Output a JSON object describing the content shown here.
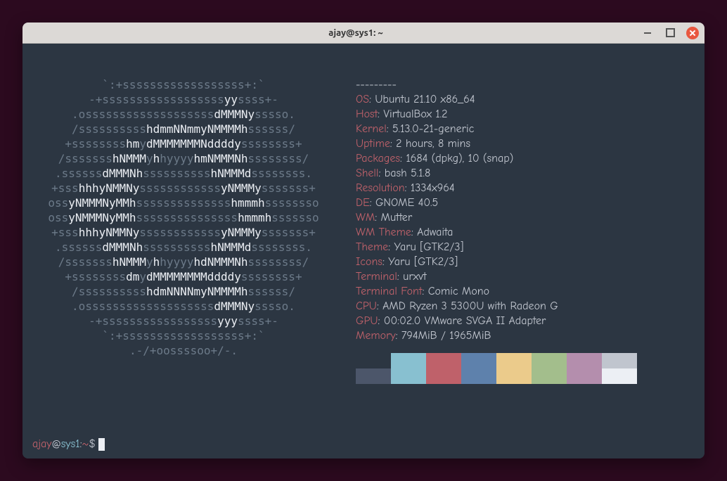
{
  "window": {
    "title": "ajay@sys1: ~"
  },
  "logo_lines": [
    [
      [
        "dim",
        "`:+"
      ],
      [
        "dim",
        "ssssssssssssssssss"
      ],
      [
        "dim",
        "+:`"
      ]
    ],
    [
      [
        "dim",
        "-+"
      ],
      [
        "dim",
        "ssssssssssssssssss"
      ],
      [
        "white",
        "yy"
      ],
      [
        "dim",
        "ssss"
      ],
      [
        "dim",
        "+-"
      ]
    ],
    [
      [
        "dim",
        ".o"
      ],
      [
        "dim",
        "sssssssssssssssssss"
      ],
      [
        "white",
        "dMMMNy"
      ],
      [
        "dim",
        "sssso."
      ]
    ],
    [
      [
        "dim",
        "/"
      ],
      [
        "dim",
        "ssssssssss"
      ],
      [
        "white",
        "hdmmNNmmyNMMMMh"
      ],
      [
        "dim",
        "ssssss/"
      ]
    ],
    [
      [
        "dim",
        "+"
      ],
      [
        "dim",
        "ssssssss"
      ],
      [
        "white",
        "hm"
      ],
      [
        "dim",
        "y"
      ],
      [
        "white",
        "dMMMMMMMNddddy"
      ],
      [
        "dim",
        "ssssssss+"
      ]
    ],
    [
      [
        "dim",
        "/"
      ],
      [
        "dim",
        "sssssss"
      ],
      [
        "white",
        "hNMMM"
      ],
      [
        "dim",
        "y"
      ],
      [
        "white",
        "h"
      ],
      [
        "dim",
        "hyyyy"
      ],
      [
        "white",
        "hmNMMMNh"
      ],
      [
        "dim",
        "ssssssss/"
      ]
    ],
    [
      [
        "dim",
        ".ssssss"
      ],
      [
        "white",
        "dMMMNh"
      ],
      [
        "dim",
        "ssssssssss"
      ],
      [
        "white",
        "hNMMMd"
      ],
      [
        "dim",
        "ssssssss."
      ]
    ],
    [
      [
        "dim",
        "+sss"
      ],
      [
        "white",
        "hhhyNMMNy"
      ],
      [
        "dim",
        "ssssssssssss"
      ],
      [
        "white",
        "yNMMMy"
      ],
      [
        "dim",
        "sssssss+"
      ]
    ],
    [
      [
        "dim",
        "oss"
      ],
      [
        "white",
        "yNMMMNyMMh"
      ],
      [
        "dim",
        "ssssssssssssss"
      ],
      [
        "white",
        "hmmmh"
      ],
      [
        "dim",
        "ssssssso"
      ]
    ],
    [
      [
        "dim",
        "oss"
      ],
      [
        "white",
        "yNMMMNyMMh"
      ],
      [
        "dim",
        "sssssssssssssss"
      ],
      [
        "white",
        "hmmmh"
      ],
      [
        "dim",
        "sssssso"
      ]
    ],
    [
      [
        "dim",
        "+sss"
      ],
      [
        "white",
        "hhhyNMMNy"
      ],
      [
        "dim",
        "ssssssssssss"
      ],
      [
        "white",
        "yNMMMy"
      ],
      [
        "dim",
        "sssssss+"
      ]
    ],
    [
      [
        "dim",
        ".ssssss"
      ],
      [
        "white",
        "dMMMNh"
      ],
      [
        "dim",
        "ssssssssss"
      ],
      [
        "white",
        "hNMMMd"
      ],
      [
        "dim",
        "ssssssss."
      ]
    ],
    [
      [
        "dim",
        "/"
      ],
      [
        "dim",
        "sssssss"
      ],
      [
        "white",
        "hNMMM"
      ],
      [
        "dim",
        "y"
      ],
      [
        "white",
        "h"
      ],
      [
        "dim",
        "hyyyy"
      ],
      [
        "white",
        "hdNMMMNh"
      ],
      [
        "dim",
        "ssssssss/"
      ]
    ],
    [
      [
        "dim",
        "+"
      ],
      [
        "dim",
        "ssssssss"
      ],
      [
        "white",
        "dm"
      ],
      [
        "dim",
        "y"
      ],
      [
        "white",
        "dMMMMMMMMddddy"
      ],
      [
        "dim",
        "ssssssss+"
      ]
    ],
    [
      [
        "dim",
        "/"
      ],
      [
        "dim",
        "ssssssssss"
      ],
      [
        "white",
        "hdmNNNNmyNMMMMh"
      ],
      [
        "dim",
        "ssssss/"
      ]
    ],
    [
      [
        "dim",
        ".o"
      ],
      [
        "dim",
        "sssssssssssssssssss"
      ],
      [
        "white",
        "dMMMNy"
      ],
      [
        "dim",
        "sssso."
      ]
    ],
    [
      [
        "dim",
        "-+"
      ],
      [
        "dim",
        "sssssssssssssssss"
      ],
      [
        "white",
        "yyy"
      ],
      [
        "dim",
        "ssss"
      ],
      [
        "dim",
        "+-"
      ]
    ],
    [
      [
        "dim",
        "`:+"
      ],
      [
        "dim",
        "ssssssssssssssssss"
      ],
      [
        "dim",
        "+:`"
      ]
    ],
    [
      [
        "dim",
        ".-/+oossssoo+/-."
      ]
    ]
  ],
  "header_rule": "---------",
  "info": [
    {
      "label": "OS",
      "value": "Ubuntu 21.10 x86_64"
    },
    {
      "label": "Host",
      "value": "VirtualBox 1.2"
    },
    {
      "label": "Kernel",
      "value": "5.13.0-21-generic"
    },
    {
      "label": "Uptime",
      "value": "2 hours, 8 mins"
    },
    {
      "label": "Packages",
      "value": "1684 (dpkg), 10 (snap)"
    },
    {
      "label": "Shell",
      "value": "bash 5.1.8"
    },
    {
      "label": "Resolution",
      "value": "1334x964"
    },
    {
      "label": "DE",
      "value": "GNOME 40.5"
    },
    {
      "label": "WM",
      "value": "Mutter"
    },
    {
      "label": "WM Theme",
      "value": "Adwaita"
    },
    {
      "label": "Theme",
      "value": "Yaru [GTK2/3]"
    },
    {
      "label": "Icons",
      "value": "Yaru [GTK2/3]"
    },
    {
      "label": "Terminal",
      "value": "urxvt"
    },
    {
      "label": "Terminal Font",
      "value": "Comic Mono"
    },
    {
      "label": "CPU",
      "value": "AMD Ryzen 3 5300U with Radeon G"
    },
    {
      "label": "GPU",
      "value": "00:02.0 VMware SVGA II Adapter"
    },
    {
      "label": "Memory",
      "value": "794MiB / 1965MiB"
    }
  ],
  "palette": {
    "row1": [
      "#2c3642",
      "#88c0d0",
      "#bf616a",
      "#5e81ac",
      "#ebcb8b",
      "#a3be8c",
      "#b48ead",
      "#c0c5ce"
    ],
    "row2": [
      "#4c566a",
      "#88c0d0",
      "#bf616a",
      "#5e81ac",
      "#ebcb8b",
      "#a3be8c",
      "#b48ead",
      "#eceff4"
    ]
  },
  "prompt": {
    "user": "ajay",
    "at": "@",
    "host": "sys1",
    "path": "~",
    "symbol": "$"
  }
}
